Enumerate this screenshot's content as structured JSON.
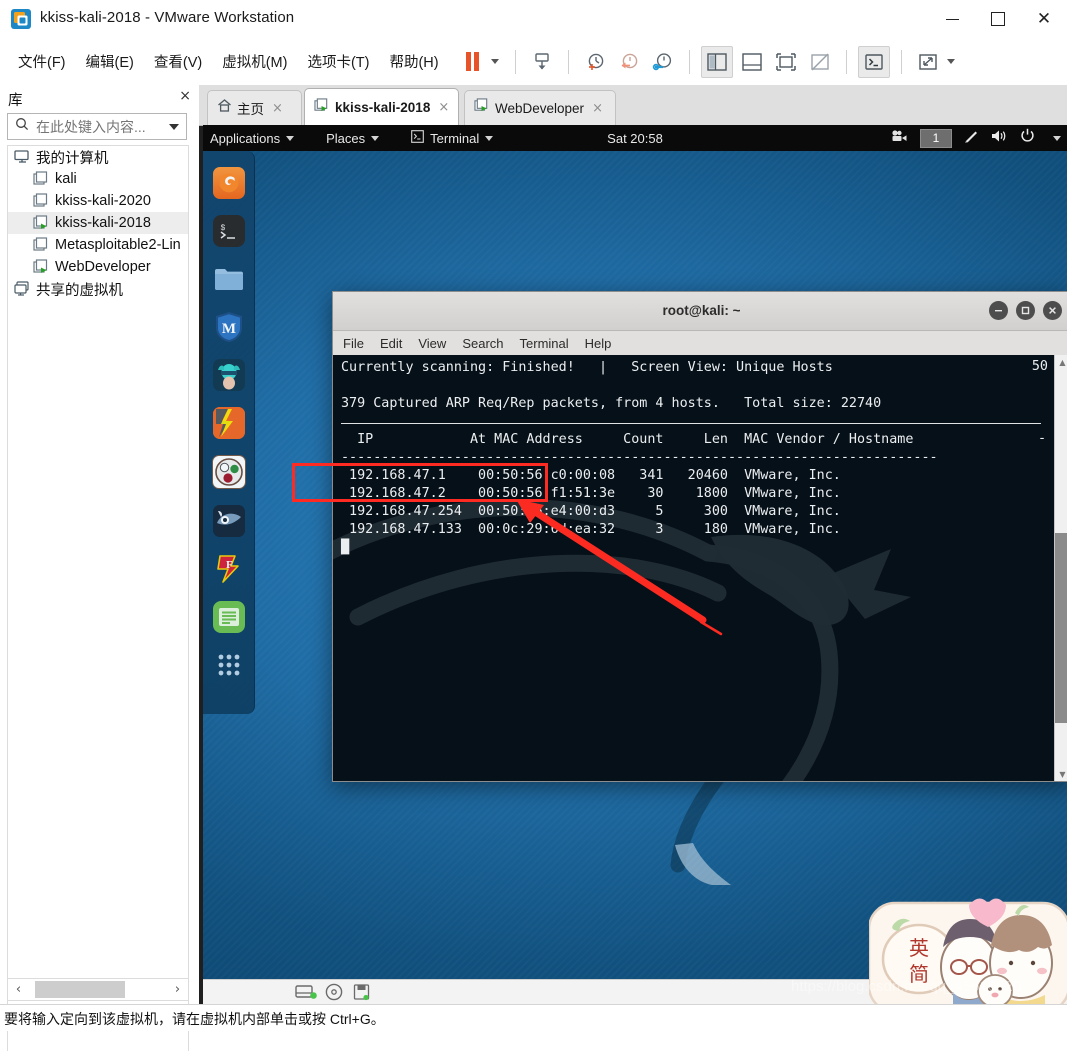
{
  "window": {
    "title": "kkiss-kali-2018 - VMware Workstation",
    "app_icon": "vmware-logo-icon",
    "minimize_label": "Minimize",
    "maximize_label": "Maximize",
    "close_label": "Close"
  },
  "menubar": {
    "items": [
      {
        "label": "文件(F)",
        "mnemonic": "F",
        "text_before": "文件(",
        "text_after": ")"
      },
      {
        "label": "编辑(E)",
        "mnemonic": "E",
        "text_before": "编辑(",
        "text_after": ")"
      },
      {
        "label": "查看(V)",
        "mnemonic": "V",
        "text_before": "查看(",
        "text_after": ")"
      },
      {
        "label": "虚拟机(M)",
        "mnemonic": "M",
        "text_before": "虚拟机(",
        "text_after": ")"
      },
      {
        "label": "选项卡(T)",
        "mnemonic": "T",
        "text_before": "选项卡(",
        "text_after": ")"
      },
      {
        "label": "帮助(H)",
        "mnemonic": "H",
        "text_before": "帮助(",
        "text_after": ")"
      }
    ],
    "toolbar_icons": [
      "pause-button-icon",
      "power-dropdown-caret-icon",
      "send-ctrl-alt-del-icon",
      "snapshot-take-icon",
      "snapshot-revert-icon",
      "snapshot-manager-icon",
      "show-library-icon",
      "show-thumbnail-bar-icon",
      "full-screen-icon",
      "unity-mode-icon",
      "console-view-icon",
      "stretch-guest-icon",
      "view-dropdown-caret-icon"
    ]
  },
  "library": {
    "title": "库",
    "close_label": "×",
    "search": {
      "placeholder": "在此处键入内容...",
      "value": "",
      "icon": "search-icon",
      "dropdown_icon": "chevron-down-icon"
    },
    "tree": [
      {
        "label": "我的计算机",
        "icon": "my-computer-icon",
        "level": 0,
        "selected": false,
        "running": false
      },
      {
        "label": "kali",
        "icon": "vm-icon",
        "level": 1,
        "selected": false,
        "running": false
      },
      {
        "label": "kkiss-kali-2020",
        "icon": "vm-icon",
        "level": 1,
        "selected": false,
        "running": false
      },
      {
        "label": "kkiss-kali-2018",
        "icon": "vm-running-icon",
        "level": 1,
        "selected": true,
        "running": true
      },
      {
        "label": "Metasploitable2-Lin",
        "icon": "vm-icon",
        "level": 1,
        "selected": false,
        "running": false
      },
      {
        "label": "WebDeveloper",
        "icon": "vm-running-icon",
        "level": 1,
        "selected": false,
        "running": true
      },
      {
        "label": "共享的虚拟机",
        "icon": "shared-vms-icon",
        "level": 0,
        "selected": false,
        "running": false
      }
    ],
    "hscroll": {
      "left_arrow": "‹",
      "right_arrow": "›"
    }
  },
  "tabs": [
    {
      "label": "主页",
      "icon": "home-icon",
      "active": false,
      "close_label": "×"
    },
    {
      "label": "kkiss-kali-2018",
      "icon": "vm-running-icon",
      "active": true,
      "close_label": "×"
    },
    {
      "label": "WebDeveloper",
      "icon": "vm-running-icon",
      "active": false,
      "close_label": "×"
    }
  ],
  "guest": {
    "topbar": {
      "applications": "Applications",
      "places": "Places",
      "terminal": "Terminal",
      "terminal_icon": "terminal-icon",
      "clock": "Sat 20:58",
      "tray": {
        "screencast_icon": "screencast-icon",
        "workspace_badge": "1",
        "brightness_icon": "brightness-pen-icon",
        "volume_icon": "volume-icon",
        "power_icon": "power-icon",
        "caret_icon": "chevron-down-icon"
      }
    },
    "dock": [
      {
        "name": "firefox-icon",
        "label": "Firefox ESR",
        "running": false
      },
      {
        "name": "terminal-icon",
        "label": "Terminal",
        "running": true
      },
      {
        "name": "files-icon",
        "label": "Files",
        "running": false
      },
      {
        "name": "metasploit-icon",
        "label": "Metasploit Framework",
        "running": false
      },
      {
        "name": "armitage-icon",
        "label": "Armitage",
        "running": false
      },
      {
        "name": "burpsuite-icon",
        "label": "Burp Suite",
        "running": false
      },
      {
        "name": "beef-icon",
        "label": "BeEF",
        "running": false
      },
      {
        "name": "wireshark-icon",
        "label": "Wireshark",
        "running": false
      },
      {
        "name": "faraday-icon",
        "label": "Faraday IDE",
        "running": false
      },
      {
        "name": "text-editor-icon",
        "label": "Text Editor",
        "running": false
      },
      {
        "name": "show-applications-icon",
        "label": "Show Applications",
        "running": false
      }
    ]
  },
  "terminal": {
    "title": "root@kali: ~",
    "window_buttons": {
      "minimize": "—",
      "maximize": "□",
      "close": "✕"
    },
    "menu": [
      "File",
      "Edit",
      "View",
      "Search",
      "Terminal",
      "Help"
    ],
    "content": {
      "status_line": "Currently scanning: Finished!   |   Screen View: Unique Hosts",
      "summary_line": "379 Captured ARP Req/Rep packets, from 4 hosts.   Total size: 22740",
      "header": "  IP            At MAC Address     Count     Len  MAC Vendor / Hostname",
      "header_right": "50",
      "divider": "--------------------------------------------------------------------------",
      "rows": [
        {
          "ip": "192.168.47.1",
          "mac": "00:50:56:c0:00:08",
          "count": "341",
          "len": "20460",
          "vendor": "VMware, Inc.",
          "highlighted": false
        },
        {
          "ip": "192.168.47.2",
          "mac": "00:50:56:f1:51:3e",
          "count": "30",
          "len": "1800",
          "vendor": "VMware, Inc.",
          "highlighted": false
        },
        {
          "ip": "192.168.47.254",
          "mac": "00:50:56:e4:00:d3",
          "count": "5",
          "len": "300",
          "vendor": "VMware, Inc.",
          "highlighted": false
        },
        {
          "ip": "192.168.47.133",
          "mac": "00:0c:29:6d:ea:32",
          "count": "3",
          "len": "180",
          "vendor": "VMware, Inc.",
          "highlighted": true
        }
      ],
      "cursor": "█",
      "right_margin_marks": [
        "-",
        "-"
      ]
    },
    "scrollbar": {
      "up_arrow": "▲",
      "down_arrow": "▼"
    }
  },
  "annotation": {
    "box_color": "#ff2a22",
    "arrow_color": "#fb2b22",
    "target_row": "192.168.47.133"
  },
  "statusbar": {
    "text": "要将输入定向到该虚拟机，请在虚拟机内部单击或按 Ctrl+G。"
  },
  "overlay": {
    "watermark": "https://blog.csdn.net/qq_45616520",
    "sticker_text_1": "英",
    "sticker_text_2": "简"
  },
  "colors": {
    "accent_orange": "#e8542a",
    "terminal_bg": "#061018",
    "desktop_blue": "#1f6ca5",
    "annotation_red": "#ff2a22"
  }
}
